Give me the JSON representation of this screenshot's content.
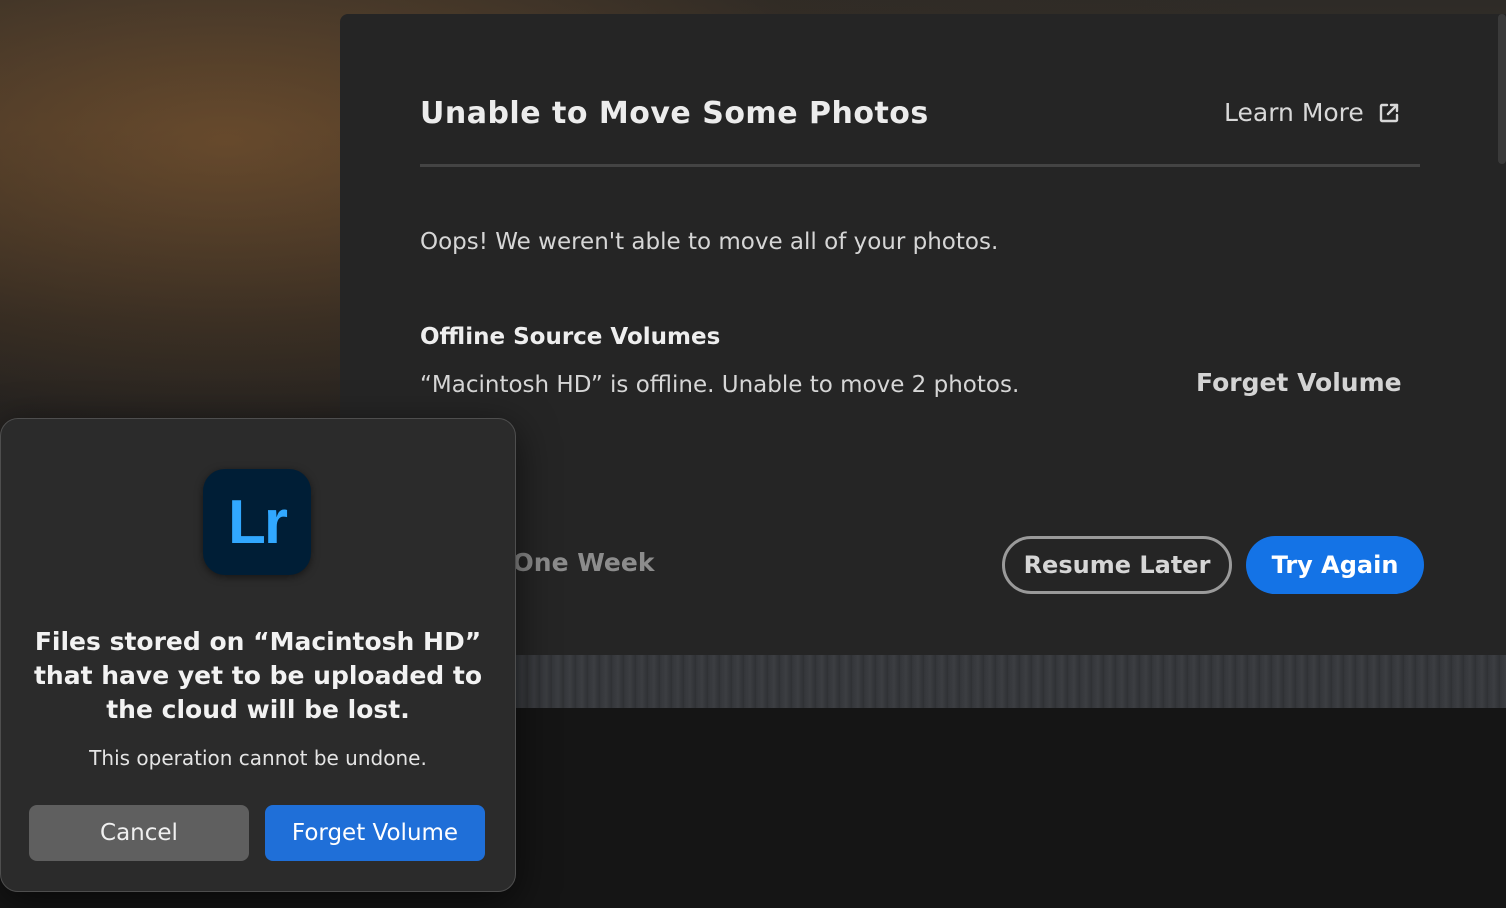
{
  "dialog": {
    "title": "Unable to Move Some Photos",
    "learn_more": "Learn More",
    "message": "Oops! We weren't able to move all of your photos.",
    "section_heading": "Offline Source Volumes",
    "volume_status": "“Macintosh HD” is offline. Unable to move 2 photos.",
    "forget_volume": "Forget Volume",
    "pause_visible_text": "ne for One Week",
    "resume_later": "Resume Later",
    "try_again": "Try Again"
  },
  "alert": {
    "icon_text": "Lr",
    "title": "Files stored on “Macintosh HD” that have yet to be uploaded to the cloud will be lost.",
    "body": "This operation cannot be undone.",
    "cancel": "Cancel",
    "confirm": "Forget Volume"
  },
  "colors": {
    "accent": "#1473e6",
    "lr_blue": "#31a8ff",
    "lr_bg": "#001e36"
  },
  "icons": {
    "learn_more": "external-link-icon"
  }
}
